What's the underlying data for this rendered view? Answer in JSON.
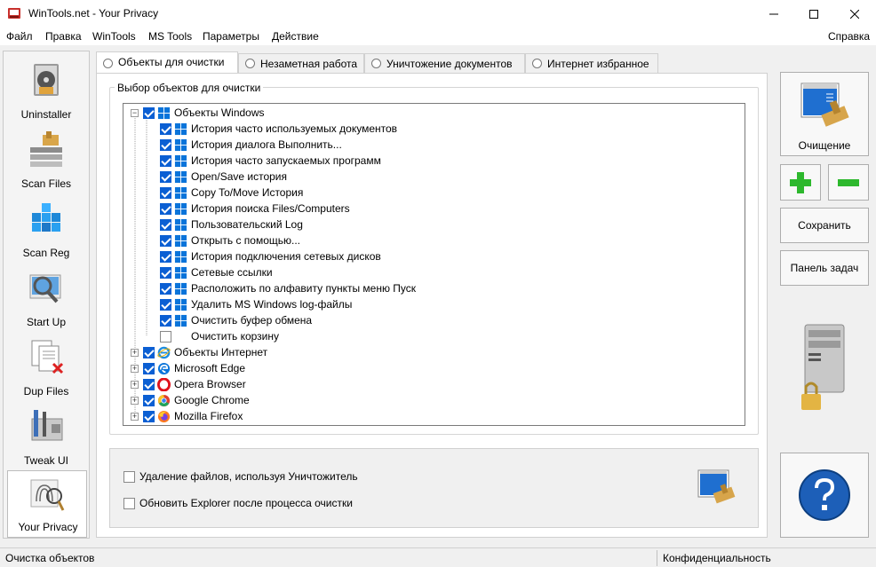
{
  "window": {
    "title": "WinTools.net - Your Privacy"
  },
  "menu": {
    "items": [
      "Файл",
      "Правка",
      "WinTools",
      "MS Tools",
      "Параметры",
      "Действие"
    ],
    "help": "Справка"
  },
  "sidebar": {
    "items": [
      {
        "label": "Uninstaller",
        "icon": "uninstaller-icon"
      },
      {
        "label": "Scan Files",
        "icon": "scan-files-icon"
      },
      {
        "label": "Scan Reg",
        "icon": "scan-reg-icon"
      },
      {
        "label": "Start Up",
        "icon": "startup-icon"
      },
      {
        "label": "Dup Files",
        "icon": "dup-files-icon"
      },
      {
        "label": "Tweak UI",
        "icon": "tweak-ui-icon"
      },
      {
        "label": "Your Privacy",
        "icon": "your-privacy-icon"
      }
    ]
  },
  "tabs": [
    {
      "label": "Объекты для очистки",
      "active": true
    },
    {
      "label": "Незаметная работа",
      "active": false
    },
    {
      "label": "Уничтожение документов",
      "active": false
    },
    {
      "label": "Интернет избранное",
      "active": false
    }
  ],
  "objects_group": {
    "legend": "Выбор объектов для очистки"
  },
  "tree": {
    "windows": {
      "label": "Объекты Windows",
      "checked": true,
      "children": [
        {
          "label": "История часто используемых документов",
          "checked": true
        },
        {
          "label": "История диалога Выполнить...",
          "checked": true
        },
        {
          "label": "История часто запускаемых программ",
          "checked": true
        },
        {
          "label": "Open/Save история",
          "checked": true
        },
        {
          "label": "Copy To/Move История",
          "checked": true
        },
        {
          "label": "История поиска Files/Computers",
          "checked": true
        },
        {
          "label": "Пользовательский Log",
          "checked": true
        },
        {
          "label": "Открыть с помощью...",
          "checked": true
        },
        {
          "label": "История подключения сетевых дисков",
          "checked": true
        },
        {
          "label": "Сетевые ссылки",
          "checked": true
        },
        {
          "label": "Расположить по алфавиту пункты меню Пуск",
          "checked": true
        },
        {
          "label": "Удалить MS Windows log-файлы",
          "checked": true
        },
        {
          "label": "Очистить буфер обмена",
          "checked": true
        },
        {
          "label": "Очистить корзину",
          "checked": false
        }
      ]
    },
    "others": [
      {
        "label": "Объекты Интернет",
        "icon": "internet-explorer-icon"
      },
      {
        "label": "Microsoft Edge",
        "icon": "edge-icon"
      },
      {
        "label": "Opera Browser",
        "icon": "opera-icon"
      },
      {
        "label": "Google Chrome",
        "icon": "chrome-icon"
      },
      {
        "label": "Mozilla Firefox",
        "icon": "firefox-icon"
      }
    ]
  },
  "options": {
    "shredder": "Удаление файлов, используя Уничтожитель",
    "refresh_explorer": "Обновить Explorer после процесса очистки"
  },
  "right_panel": {
    "clean_label": "Очищение",
    "save_label": "Сохранить",
    "taskbar_label": "Панель задач"
  },
  "status": {
    "left": "Очистка объектов",
    "right": "Конфиденциальность"
  },
  "colors": {
    "checkbox_blue": "#0b5fd3",
    "plus_green": "#2db82d",
    "help_blue": "#1d5fb8"
  }
}
